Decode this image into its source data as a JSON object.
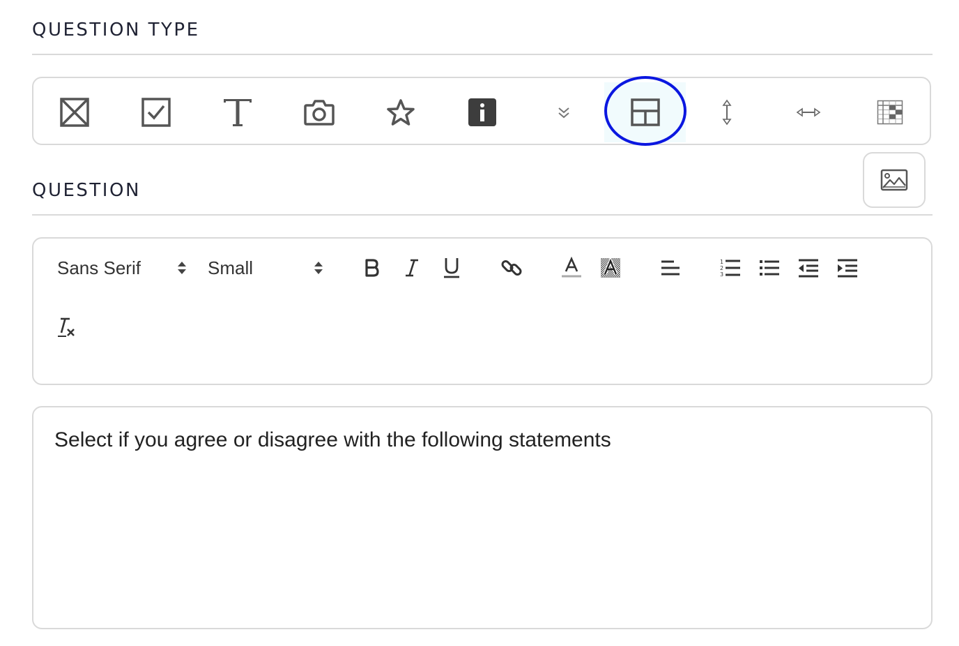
{
  "question_type": {
    "heading": "QUESTION TYPE",
    "types": [
      {
        "id": "single-choice",
        "icon": "boxed-x-icon"
      },
      {
        "id": "multiple-choice",
        "icon": "checkbox-icon"
      },
      {
        "id": "text",
        "icon": "text-t-icon"
      },
      {
        "id": "photo",
        "icon": "camera-icon"
      },
      {
        "id": "rating",
        "icon": "star-icon"
      },
      {
        "id": "info",
        "icon": "info-icon"
      },
      {
        "id": "dropdown",
        "icon": "double-chevron-down-icon"
      },
      {
        "id": "matrix",
        "icon": "grid-layout-icon",
        "selected": true
      },
      {
        "id": "vertical-scale",
        "icon": "vertical-arrows-icon"
      },
      {
        "id": "horizontal-scale",
        "icon": "horizontal-arrows-icon"
      },
      {
        "id": "table",
        "icon": "table-icon"
      }
    ],
    "highlight_color": "#0b17e0",
    "selected_background": "#f1fbfd"
  },
  "image_button": {
    "icon": "image-icon"
  },
  "question": {
    "heading": "QUESTION",
    "toolbar": {
      "font_picker": "Sans Serif",
      "size_picker": "Small",
      "tools": [
        "bold-icon",
        "italic-icon",
        "underline-icon",
        "link-icon",
        "text-color-icon",
        "background-color-icon",
        "align-left-icon",
        "ordered-list-icon",
        "bullet-list-icon",
        "outdent-icon",
        "indent-icon",
        "clear-format-icon"
      ]
    },
    "text": "Select if you agree or disagree with the following statements"
  }
}
